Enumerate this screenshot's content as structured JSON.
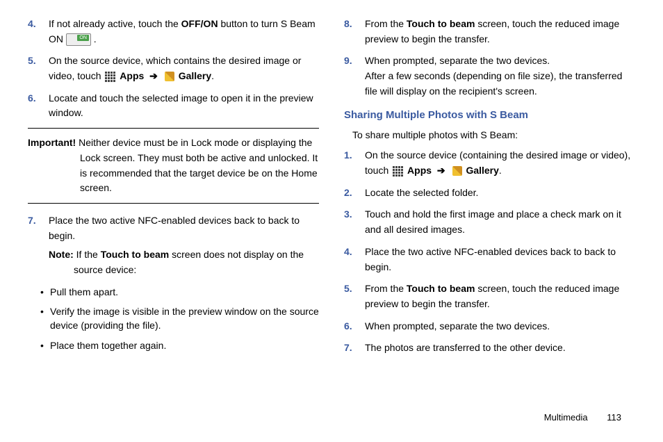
{
  "left": {
    "items": [
      {
        "n": "4.",
        "pre": "If not already active, touch the ",
        "b1": "OFF/ON",
        "mid": " button to turn S Beam ON ",
        "icon": "toggle",
        "post": " ."
      },
      {
        "n": "5.",
        "pre": "On the source device, which contains the desired image or video, touch ",
        "apps": "Apps",
        "arrow": "➔",
        "gallery": "Gallery",
        "post": "."
      },
      {
        "n": "6.",
        "text": "Locate and touch the selected image to open it in the preview window."
      }
    ],
    "important_label": "Important!",
    "important_text": " Neither device must be in Lock mode or displaying the Lock screen. They must both be active and unlocked. It is recommended that the target device be on the Home screen.",
    "items2": [
      {
        "n": "7.",
        "text": "Place the two active NFC-enabled devices back to back to begin.",
        "note_label": "Note:",
        "note_text": " If the ",
        "note_bold": "Touch to beam",
        "note_after": " screen does not display on the source device:"
      }
    ],
    "bullets": [
      "Pull them apart.",
      "Verify the image is visible in the preview window on the source device (providing the file).",
      "Place them together again."
    ]
  },
  "right": {
    "items": [
      {
        "n": "8.",
        "pre": "From the ",
        "b": "Touch to beam",
        "post": " screen, touch the reduced image preview to begin the transfer."
      },
      {
        "n": "9.",
        "line1": "When prompted, separate the two devices.",
        "line2": "After a few seconds (depending on file size), the transferred file will display on the recipient's screen."
      }
    ],
    "section": "Sharing Multiple Photos with S Beam",
    "intro": "To share multiple photos with S Beam:",
    "steps": [
      {
        "n": "1.",
        "pre": "On the source device (containing the desired image or video), touch ",
        "apps": "Apps",
        "arrow": "➔",
        "gallery": "Gallery",
        "post": "."
      },
      {
        "n": "2.",
        "text": "Locate the selected folder."
      },
      {
        "n": "3.",
        "text": "Touch and hold the first image and place a check mark on it and all desired images."
      },
      {
        "n": "4.",
        "text": "Place the two active NFC-enabled devices back to back to begin."
      },
      {
        "n": "5.",
        "pre": "From the ",
        "b": "Touch to beam",
        "post": " screen, touch the reduced image preview to begin the transfer."
      },
      {
        "n": "6.",
        "text": "When prompted, separate the two devices."
      },
      {
        "n": "7.",
        "text": "The photos are transferred to the other device."
      }
    ]
  },
  "footer": {
    "section": "Multimedia",
    "page": "113"
  }
}
